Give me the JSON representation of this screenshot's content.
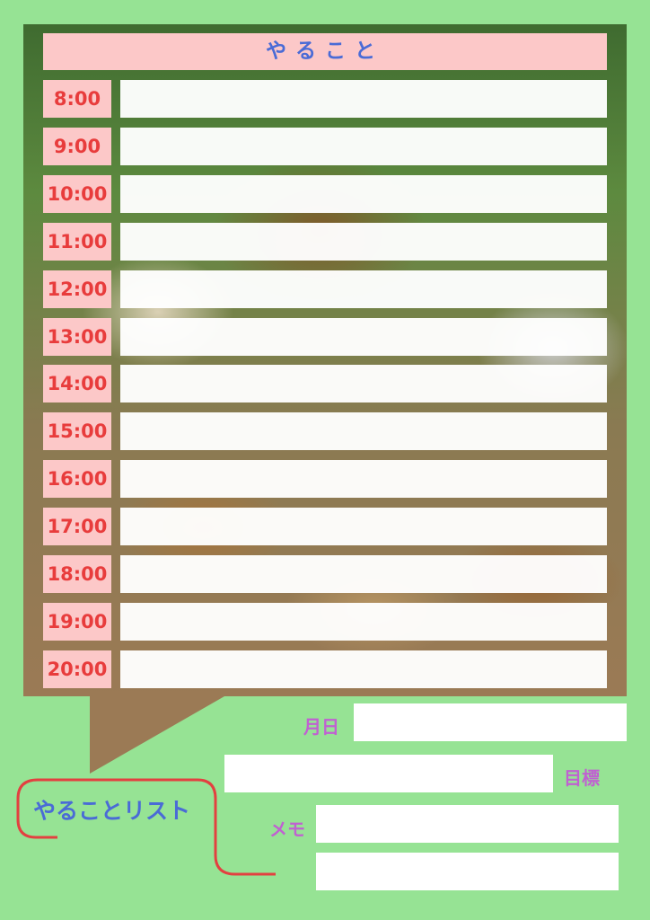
{
  "title": "やること",
  "times": [
    "8:00",
    "9:00",
    "10:00",
    "11:00",
    "12:00",
    "13:00",
    "14:00",
    "15:00",
    "16:00",
    "17:00",
    "18:00",
    "19:00",
    "20:00"
  ],
  "labels": {
    "date": "月日",
    "goal": "目標",
    "memo": "メモ"
  },
  "list_title": "やることリスト",
  "colors": {
    "background": "#96e394",
    "header_bg": "#fcc8c8",
    "time_text": "#e83c3c",
    "title_text": "#4a6bd6",
    "label_text": "#c061d1",
    "callout_line": "#e34040"
  }
}
